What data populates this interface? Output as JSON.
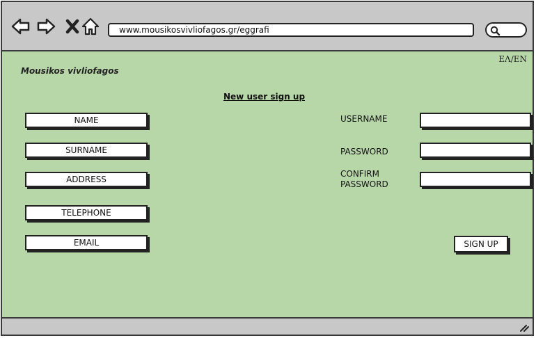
{
  "browser": {
    "url": "www.mousikosvivliofagos.gr/eggrafi",
    "icons": [
      "back-arrow-icon",
      "forward-arrow-icon",
      "close-icon",
      "home-icon",
      "search-icon",
      "resize-grip-icon"
    ]
  },
  "header": {
    "language_toggle": "ΕΛ/EN",
    "brand": "Mousikos vivliofagos"
  },
  "form": {
    "title": "New user sign up",
    "left_fields": [
      "NAME",
      "SURNAME",
      "ADDRESS",
      "TELEPHONE",
      "EMAIL"
    ],
    "right_labels": {
      "username": "USERNAME",
      "password": "PASSWORD",
      "confirm_line1": "CONFIRM",
      "confirm_line2": "PASSWORD"
    },
    "submit_label": "SIGN UP"
  },
  "colors": {
    "page_background": "#b7d7a8",
    "chrome_background": "#c8c8c8"
  }
}
